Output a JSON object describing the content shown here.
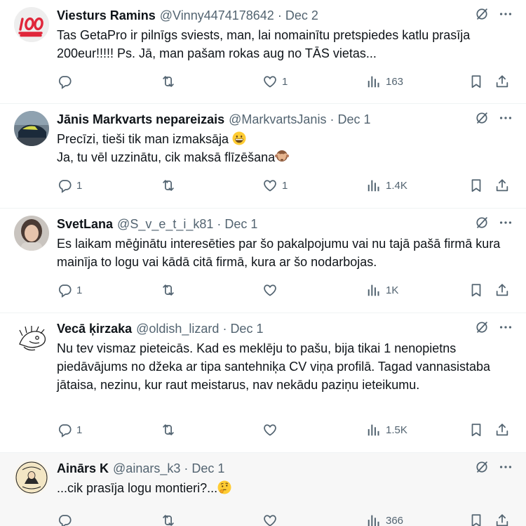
{
  "tweets": [
    {
      "name": "Viesturs Ramins",
      "handle": "@Vinny4474178642",
      "date": "Dec 2",
      "text": "Tas GetaPro ir pilnīgs sviests, man, lai nomainītu pretspiedes katlu prasīja 200eur!!!!! Ps. Jā, man pašam rokas aug no TĀS vietas...",
      "avatar": "100-emoji",
      "replies": "",
      "retweets": "",
      "likes": "1",
      "views": "163"
    },
    {
      "name": "Jānis Markvarts nepareizais",
      "handle": "@MarkvartsJanis",
      "date": "Dec 1",
      "text_line1": "Precīzi, tieši tik man izmaksāja",
      "text_line2": "Ja, tu vēl uzzinātu, cik maksā flīzēšana",
      "emoji1": "grinning-face",
      "emoji2": "see-no-evil-monkey",
      "avatar": "car-photo",
      "replies": "1",
      "retweets": "",
      "likes": "1",
      "views": "1.4K"
    },
    {
      "name": "SvetLana",
      "handle": "@S_v_e_t_i_k81",
      "date": "Dec 1",
      "text": "Es laikam mēģinātu interesēties par šo pakalpojumu vai nu tajā pašā firmā kura mainīja to logu vai kādā citā firmā, kura ar šo nodarbojas.",
      "avatar": "woman-photo",
      "replies": "1",
      "retweets": "",
      "likes": "",
      "views": "1K"
    },
    {
      "name": "Vecā ķirzaka",
      "handle": "@oldish_lizard",
      "date": "Dec 1",
      "text": "Nu tev vismaz pieteicās. Kad es meklēju to pašu, bija tikai 1 nenopietns piedāvājums no džeka ar tipa santehniķa CV viņa profilā. Tagad vannasistaba jātaisa, nezinu, kur raut meistarus, nav nekādu paziņu ieteikumu.",
      "avatar": "lizard-sketch",
      "replies": "1",
      "retweets": "",
      "likes": "",
      "views": "1.5K"
    },
    {
      "name": "Ainārs K",
      "handle": "@ainars_k3",
      "date": "Dec 1",
      "text": "...cik prasīja logu montieri?...",
      "emoji": "thinking-face",
      "avatar": "cartoon-badge",
      "replies": "",
      "retweets": "",
      "likes": "",
      "views": "366"
    }
  ],
  "colors": {
    "text": "#0f1419",
    "muted": "#536471",
    "divider": "#eff3f4",
    "hover": "#f7f7f7"
  }
}
